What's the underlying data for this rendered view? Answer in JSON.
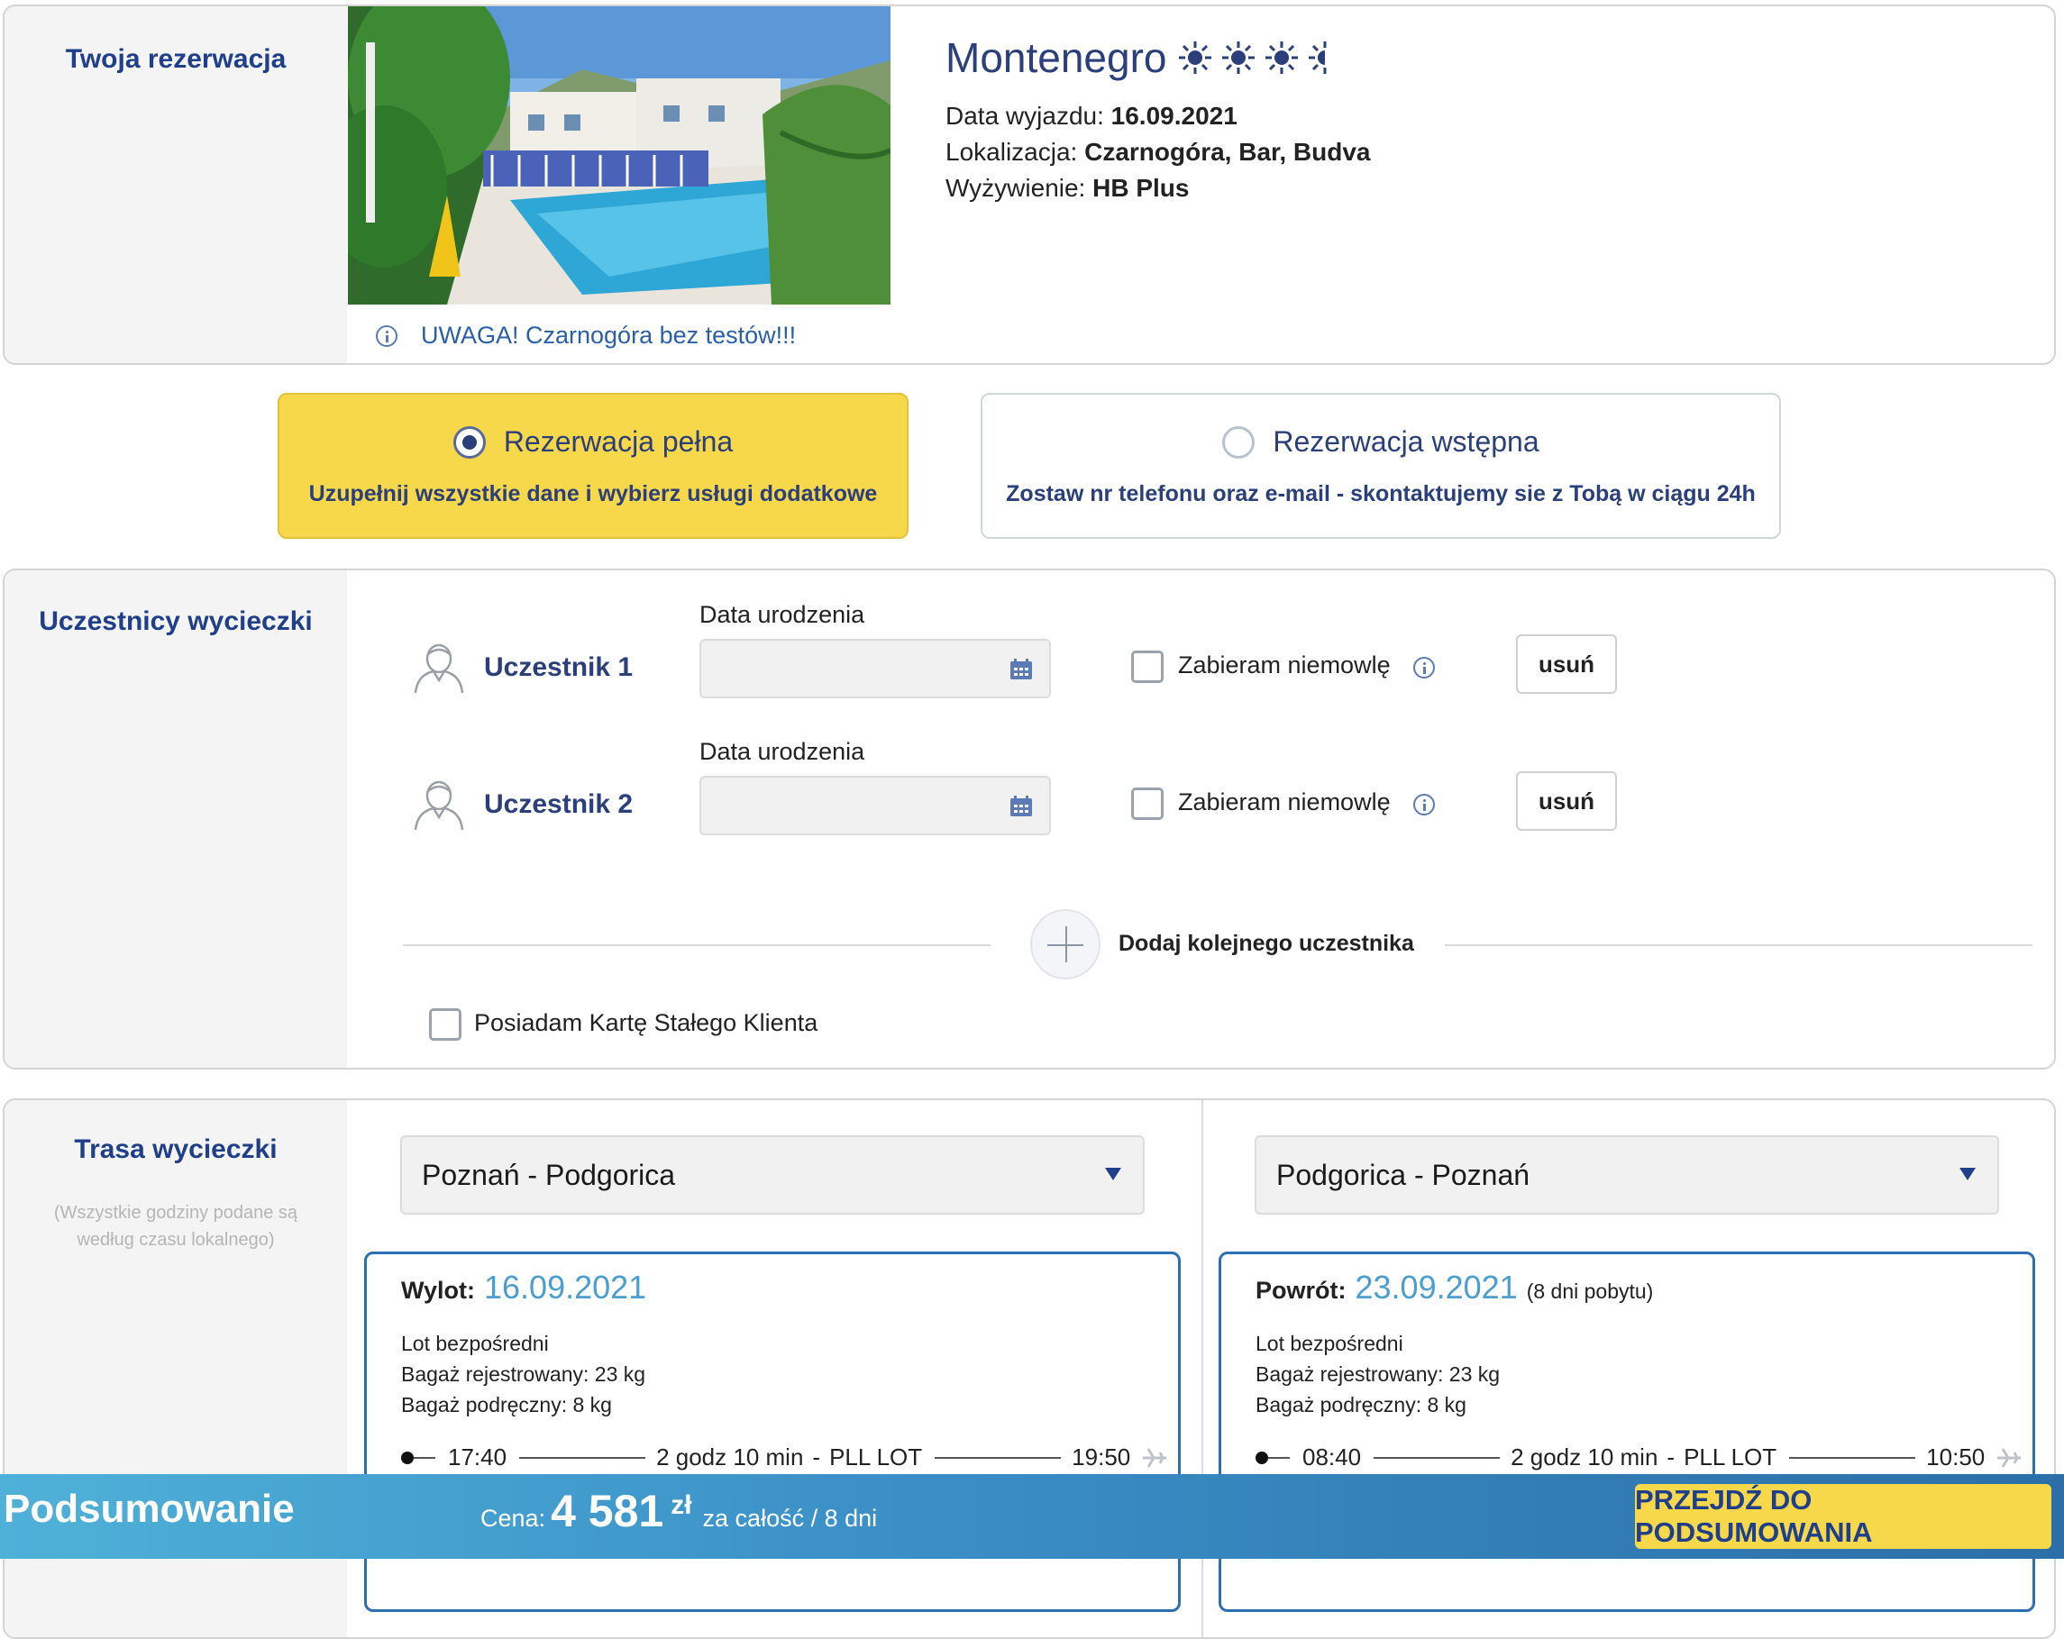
{
  "reservation": {
    "section_title": "Twoja rezerwacja",
    "hotel_name": "Montenegro",
    "sun_rating": 3.5,
    "departure_label": "Data wyjazdu:",
    "departure_value": "16.09.2021",
    "location_label": "Lokalizacja:",
    "location_value": "Czarnogóra, Bar, Budva",
    "board_label": "Wyżywienie:",
    "board_value": "HB Plus",
    "alert_text": "UWAGA! Czarnogóra bez testów!!!"
  },
  "booking_type": {
    "full": {
      "title": "Rezerwacja pełna",
      "subtitle": "Uzupełnij wszystkie dane i wybierz usługi dodatkowe",
      "selected": true
    },
    "pre": {
      "title": "Rezerwacja wstępna",
      "subtitle": "Zostaw nr telefonu oraz e-mail - skontaktujemy sie z Tobą w ciągu 24h",
      "selected": false
    }
  },
  "participants": {
    "section_title": "Uczestnicy wycieczki",
    "list": [
      {
        "name": "Uczestnik 1",
        "dob_label": "Data urodzenia",
        "infant_label": "Zabieram niemowlę",
        "remove_label": "usuń"
      },
      {
        "name": "Uczestnik 2",
        "dob_label": "Data urodzenia",
        "infant_label": "Zabieram niemowlę",
        "remove_label": "usuń"
      }
    ],
    "add_label": "Dodaj kolejnego uczestnika",
    "loyalty_label": "Posiadam Kartę Stałego Klienta"
  },
  "route": {
    "section_title": "Trasa wycieczki",
    "note": "(Wszystkie godziny podane są według czasu lokalnego)",
    "outbound": {
      "select_value": "Poznań - Podgorica",
      "head_label": "Wylot:",
      "date": "16.09.2021",
      "extra": "",
      "lines": [
        "Lot bezpośredni",
        "Bagaż rejestrowany: 23 kg",
        "Bagaż podręczny: 8 kg"
      ],
      "dep_time": "17:40",
      "duration": "2 godz 10 min",
      "sep": "-",
      "carrier": "PLL LOT",
      "arr_time": "19:50"
    },
    "inbound": {
      "select_value": "Podgorica - Poznań",
      "head_label": "Powrót:",
      "date": "23.09.2021",
      "extra": "(8 dni pobytu)",
      "lines": [
        "Lot bezpośredni",
        "Bagaż rejestrowany: 23 kg",
        "Bagaż podręczny: 8 kg"
      ],
      "dep_time": "08:40",
      "duration": "2 godz 10 min",
      "sep": "-",
      "carrier": "PLL LOT",
      "arr_time": "10:50"
    }
  },
  "summary": {
    "title": "Podsumowanie",
    "price_label": "Cena:",
    "price_value": "4 581",
    "currency": "zł",
    "price_suffix": "za całość / 8 dni",
    "cta_label": "PRZEJDŹ DO PODSUMOWANIA"
  },
  "colors": {
    "brand_navy": "#1f3f8a",
    "accent_yellow": "#f7d84b",
    "date_blue": "#4b9fd0",
    "card_border": "#2d6fb3"
  }
}
